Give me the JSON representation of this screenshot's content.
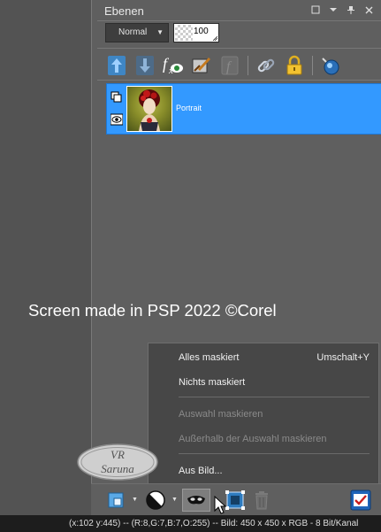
{
  "panel": {
    "title": "Ebenen",
    "title_controls": [
      "maximize-icon",
      "dropdown-icon",
      "pin-icon",
      "close-icon"
    ],
    "blend_mode": "Normal",
    "opacity": "100"
  },
  "toolbar_icons": [
    "move-layer-up-icon",
    "move-layer-down-icon",
    "fx-visibility-icon",
    "edit-palette-icon",
    "function-icon",
    "link-icon",
    "lock-icon",
    "globe-icon"
  ],
  "layers": [
    {
      "name": "Portrait",
      "selected": true,
      "visible": true
    }
  ],
  "watermark": "Screen made in PSP 2022 ©Corel",
  "context_menu": {
    "items": [
      {
        "label": "Alles maskiert",
        "shortcut": "Umschalt+Y",
        "enabled": true
      },
      {
        "label": "Nichts maskiert",
        "shortcut": "",
        "enabled": true
      },
      {
        "label": "Auswahl maskieren",
        "shortcut": "",
        "enabled": false
      },
      {
        "label": "Außerhalb der Auswahl maskieren",
        "shortcut": "",
        "enabled": false
      },
      {
        "label": "Aus Bild...",
        "shortcut": "",
        "enabled": true
      }
    ]
  },
  "logo_text": "VR Saruna",
  "status_bar": "(x:102 y:445) -- (R:8,G:7,B:7,O:255) -- Bild:  450 x 450 x RGB - 8 Bit/Kanal",
  "colors": {
    "panel_bg": "#5f5f5f",
    "selected_layer": "#3399ff",
    "menu_bg": "#474747",
    "status_bg": "#1d1d1d"
  }
}
